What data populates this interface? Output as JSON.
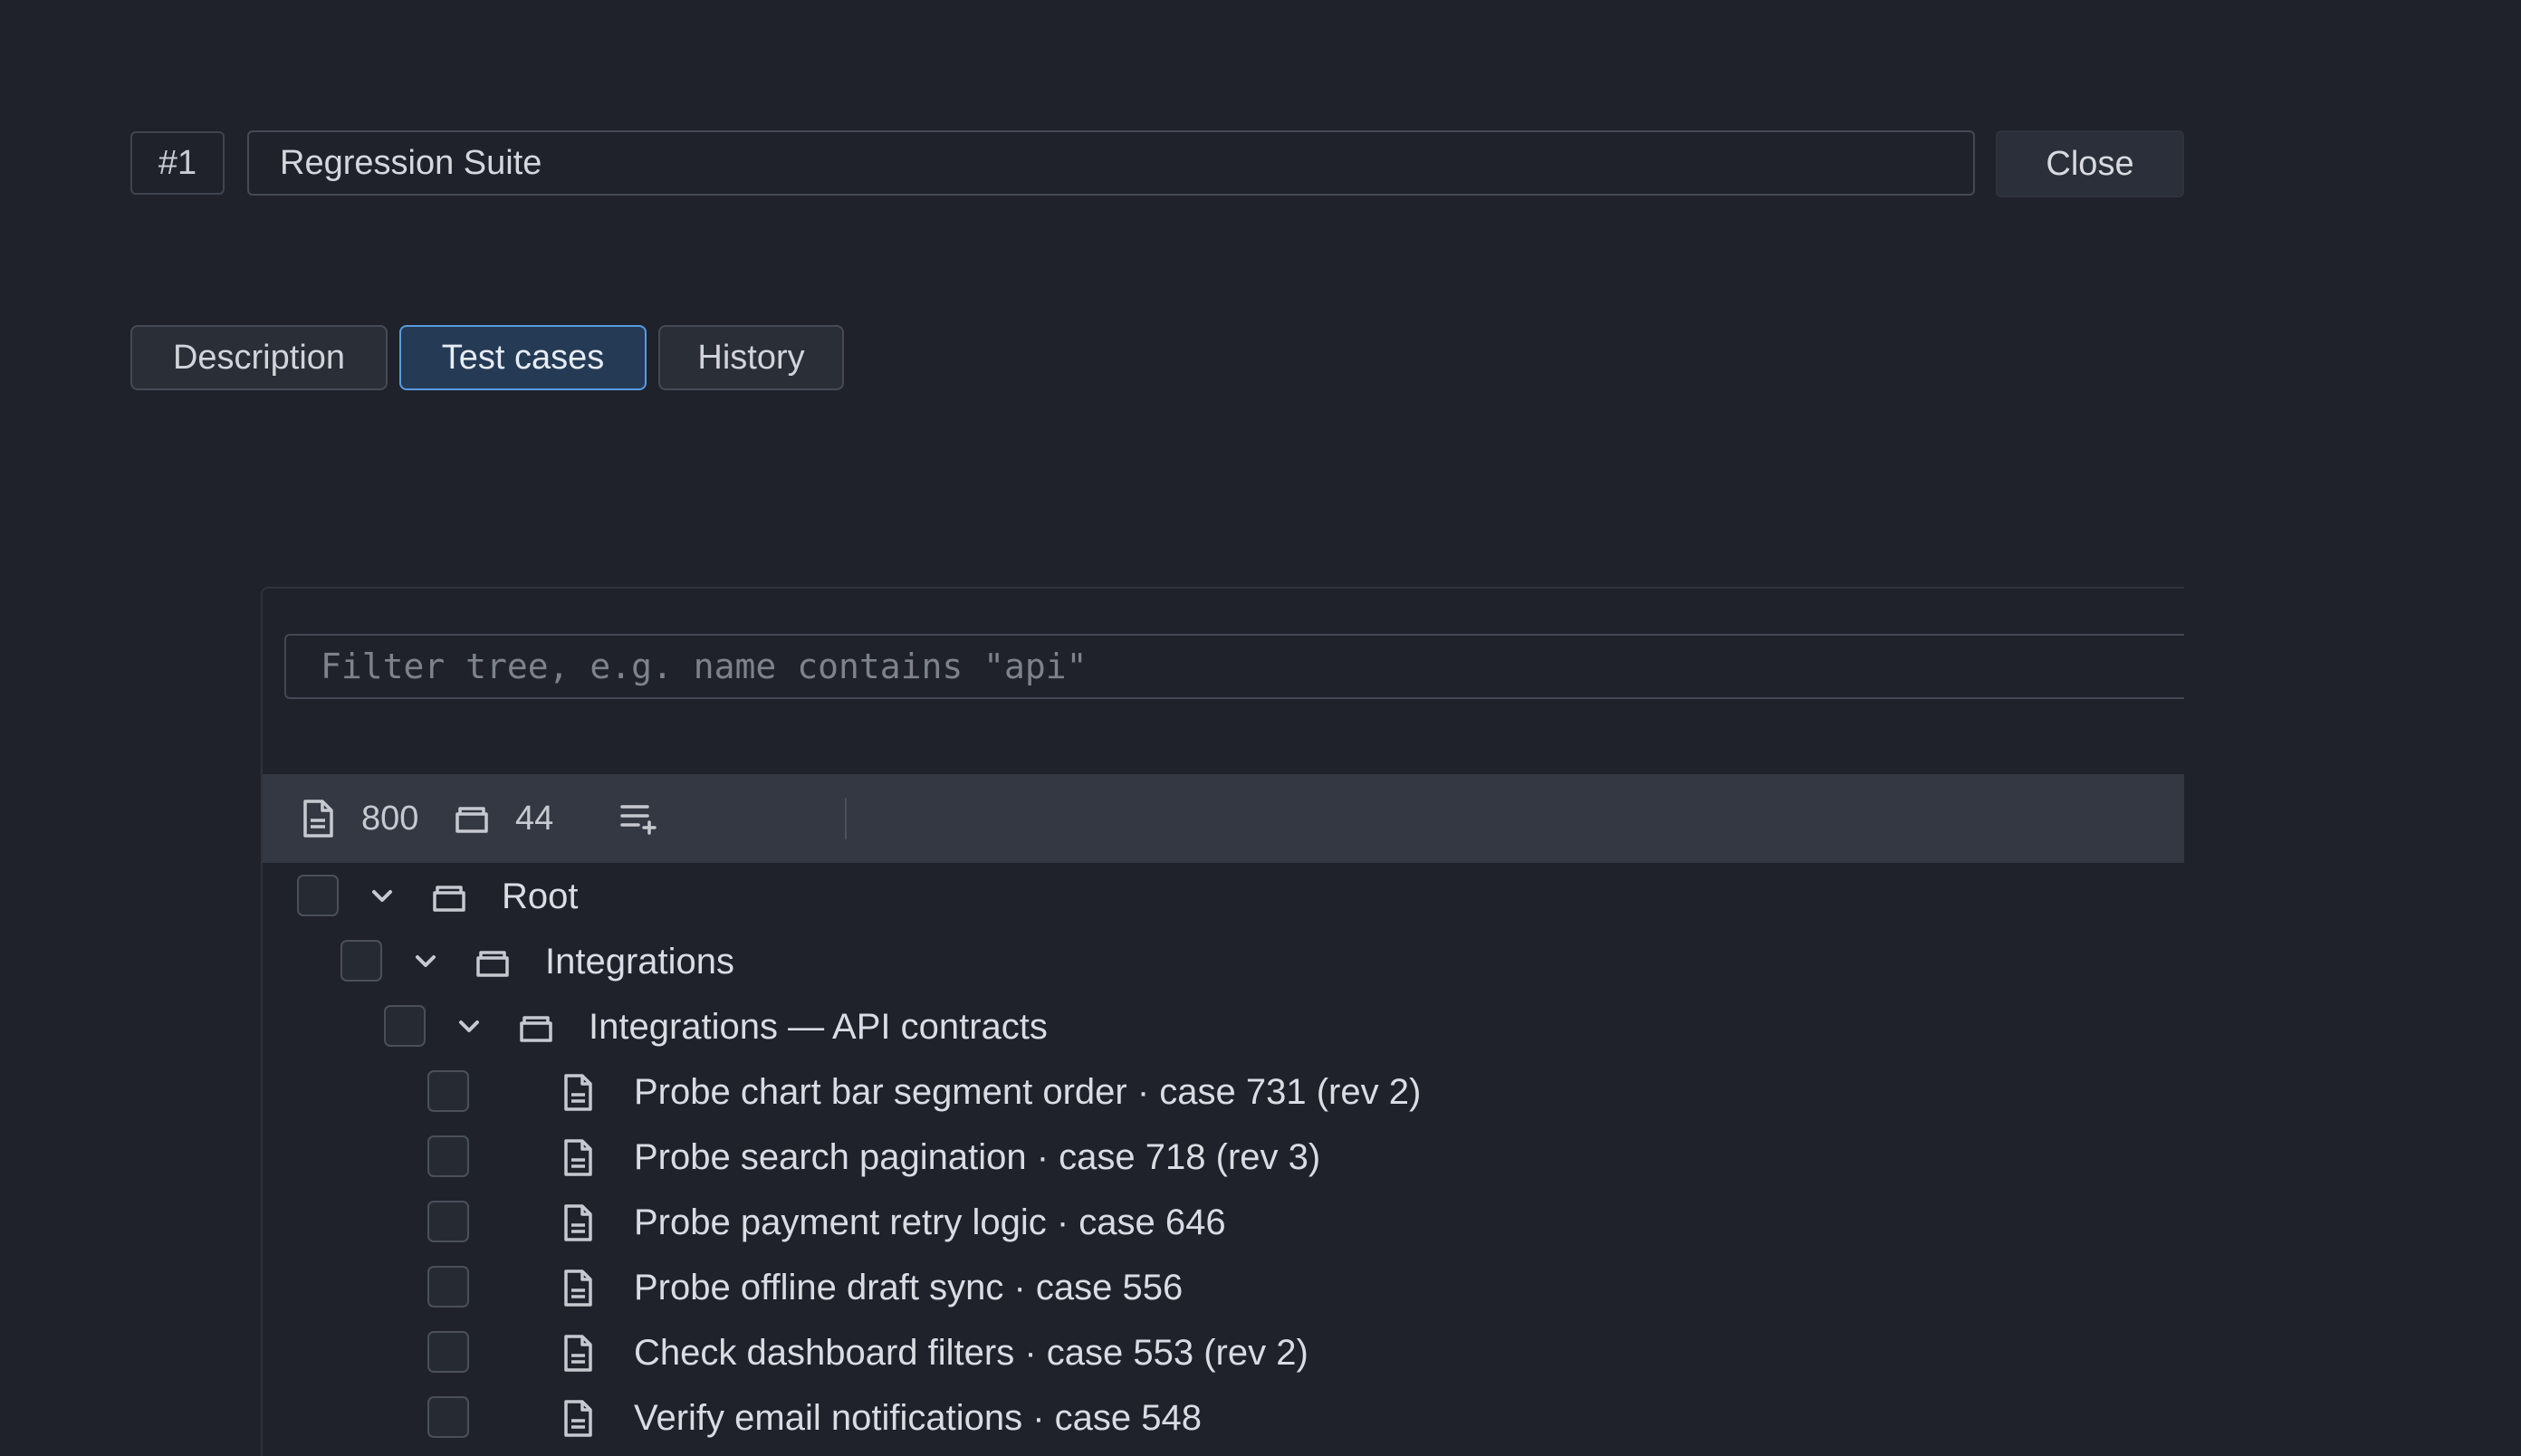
{
  "header": {
    "id_badge": "#1",
    "title_value": "Regression Suite",
    "close_label": "Close"
  },
  "tabs": [
    {
      "label": "Description",
      "active": false
    },
    {
      "label": "Test cases",
      "active": true
    },
    {
      "label": "History",
      "active": false
    }
  ],
  "filter": {
    "placeholder": "Filter tree, e.g. name contains \"api\""
  },
  "toolbar": {
    "case_count": "800",
    "folder_count": "44",
    "icons": [
      "document-icon",
      "folder-icon",
      "add-list-icon"
    ]
  },
  "tree": [
    {
      "type": "folder",
      "label": "Root",
      "expanded": true
    },
    {
      "type": "folder",
      "label": "Integrations",
      "expanded": true
    },
    {
      "type": "folder",
      "label": "Integrations — API contracts",
      "expanded": true
    },
    {
      "type": "case",
      "label": "Probe chart bar segment order · case 731 (rev 2)"
    },
    {
      "type": "case",
      "label": "Probe search pagination · case 718 (rev 3)"
    },
    {
      "type": "case",
      "label": "Probe payment retry logic · case 646"
    },
    {
      "type": "case",
      "label": "Probe offline draft sync · case 556"
    },
    {
      "type": "case",
      "label": "Check dashboard filters · case 553 (rev 2)"
    },
    {
      "type": "case",
      "label": "Verify email notifications · case 548"
    }
  ],
  "colors": {
    "background": "#1f222b",
    "accent": "#5a9ae0",
    "active_tab_bg": "#253a55",
    "toolbar_bg": "#343843"
  }
}
